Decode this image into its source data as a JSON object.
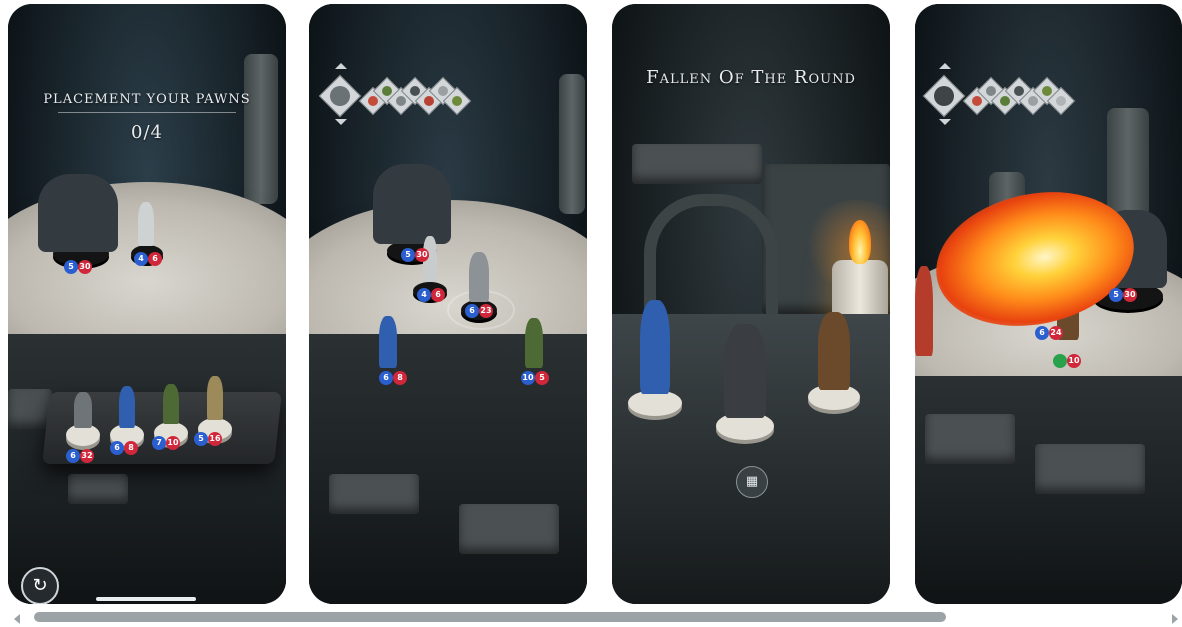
{
  "screenshots": [
    {
      "title": "PLACEMENT YOUR PAWNS",
      "counter": "0/4",
      "board_badges": [
        {
          "blue": "5",
          "red": "30"
        },
        {
          "blue": "4",
          "red": "6"
        }
      ],
      "tray_badges": [
        {
          "blue": "6",
          "red": "32"
        },
        {
          "blue": "6",
          "red": "8"
        },
        {
          "blue": "7",
          "red": "10"
        },
        {
          "blue": "5",
          "red": "16"
        }
      ],
      "restart_icon": "↻"
    },
    {
      "badges": [
        {
          "blue": "5",
          "red": "30"
        },
        {
          "blue": "4",
          "red": "6"
        },
        {
          "blue": "6",
          "red": "23"
        },
        {
          "blue": "6",
          "red": "8"
        },
        {
          "blue": "10",
          "red": "5"
        }
      ]
    },
    {
      "title": "Fallen Of The Round",
      "camera_icon": "▦"
    },
    {
      "badges": [
        {
          "blue": "5",
          "red": "30"
        },
        {
          "blue": "6",
          "red": "24"
        },
        {
          "blue": "",
          "red": "10"
        }
      ]
    }
  ],
  "colors": {
    "badge_blue": "#2b5fd0",
    "badge_red": "#d0283a",
    "scrollbar": "#9ca3a7"
  }
}
